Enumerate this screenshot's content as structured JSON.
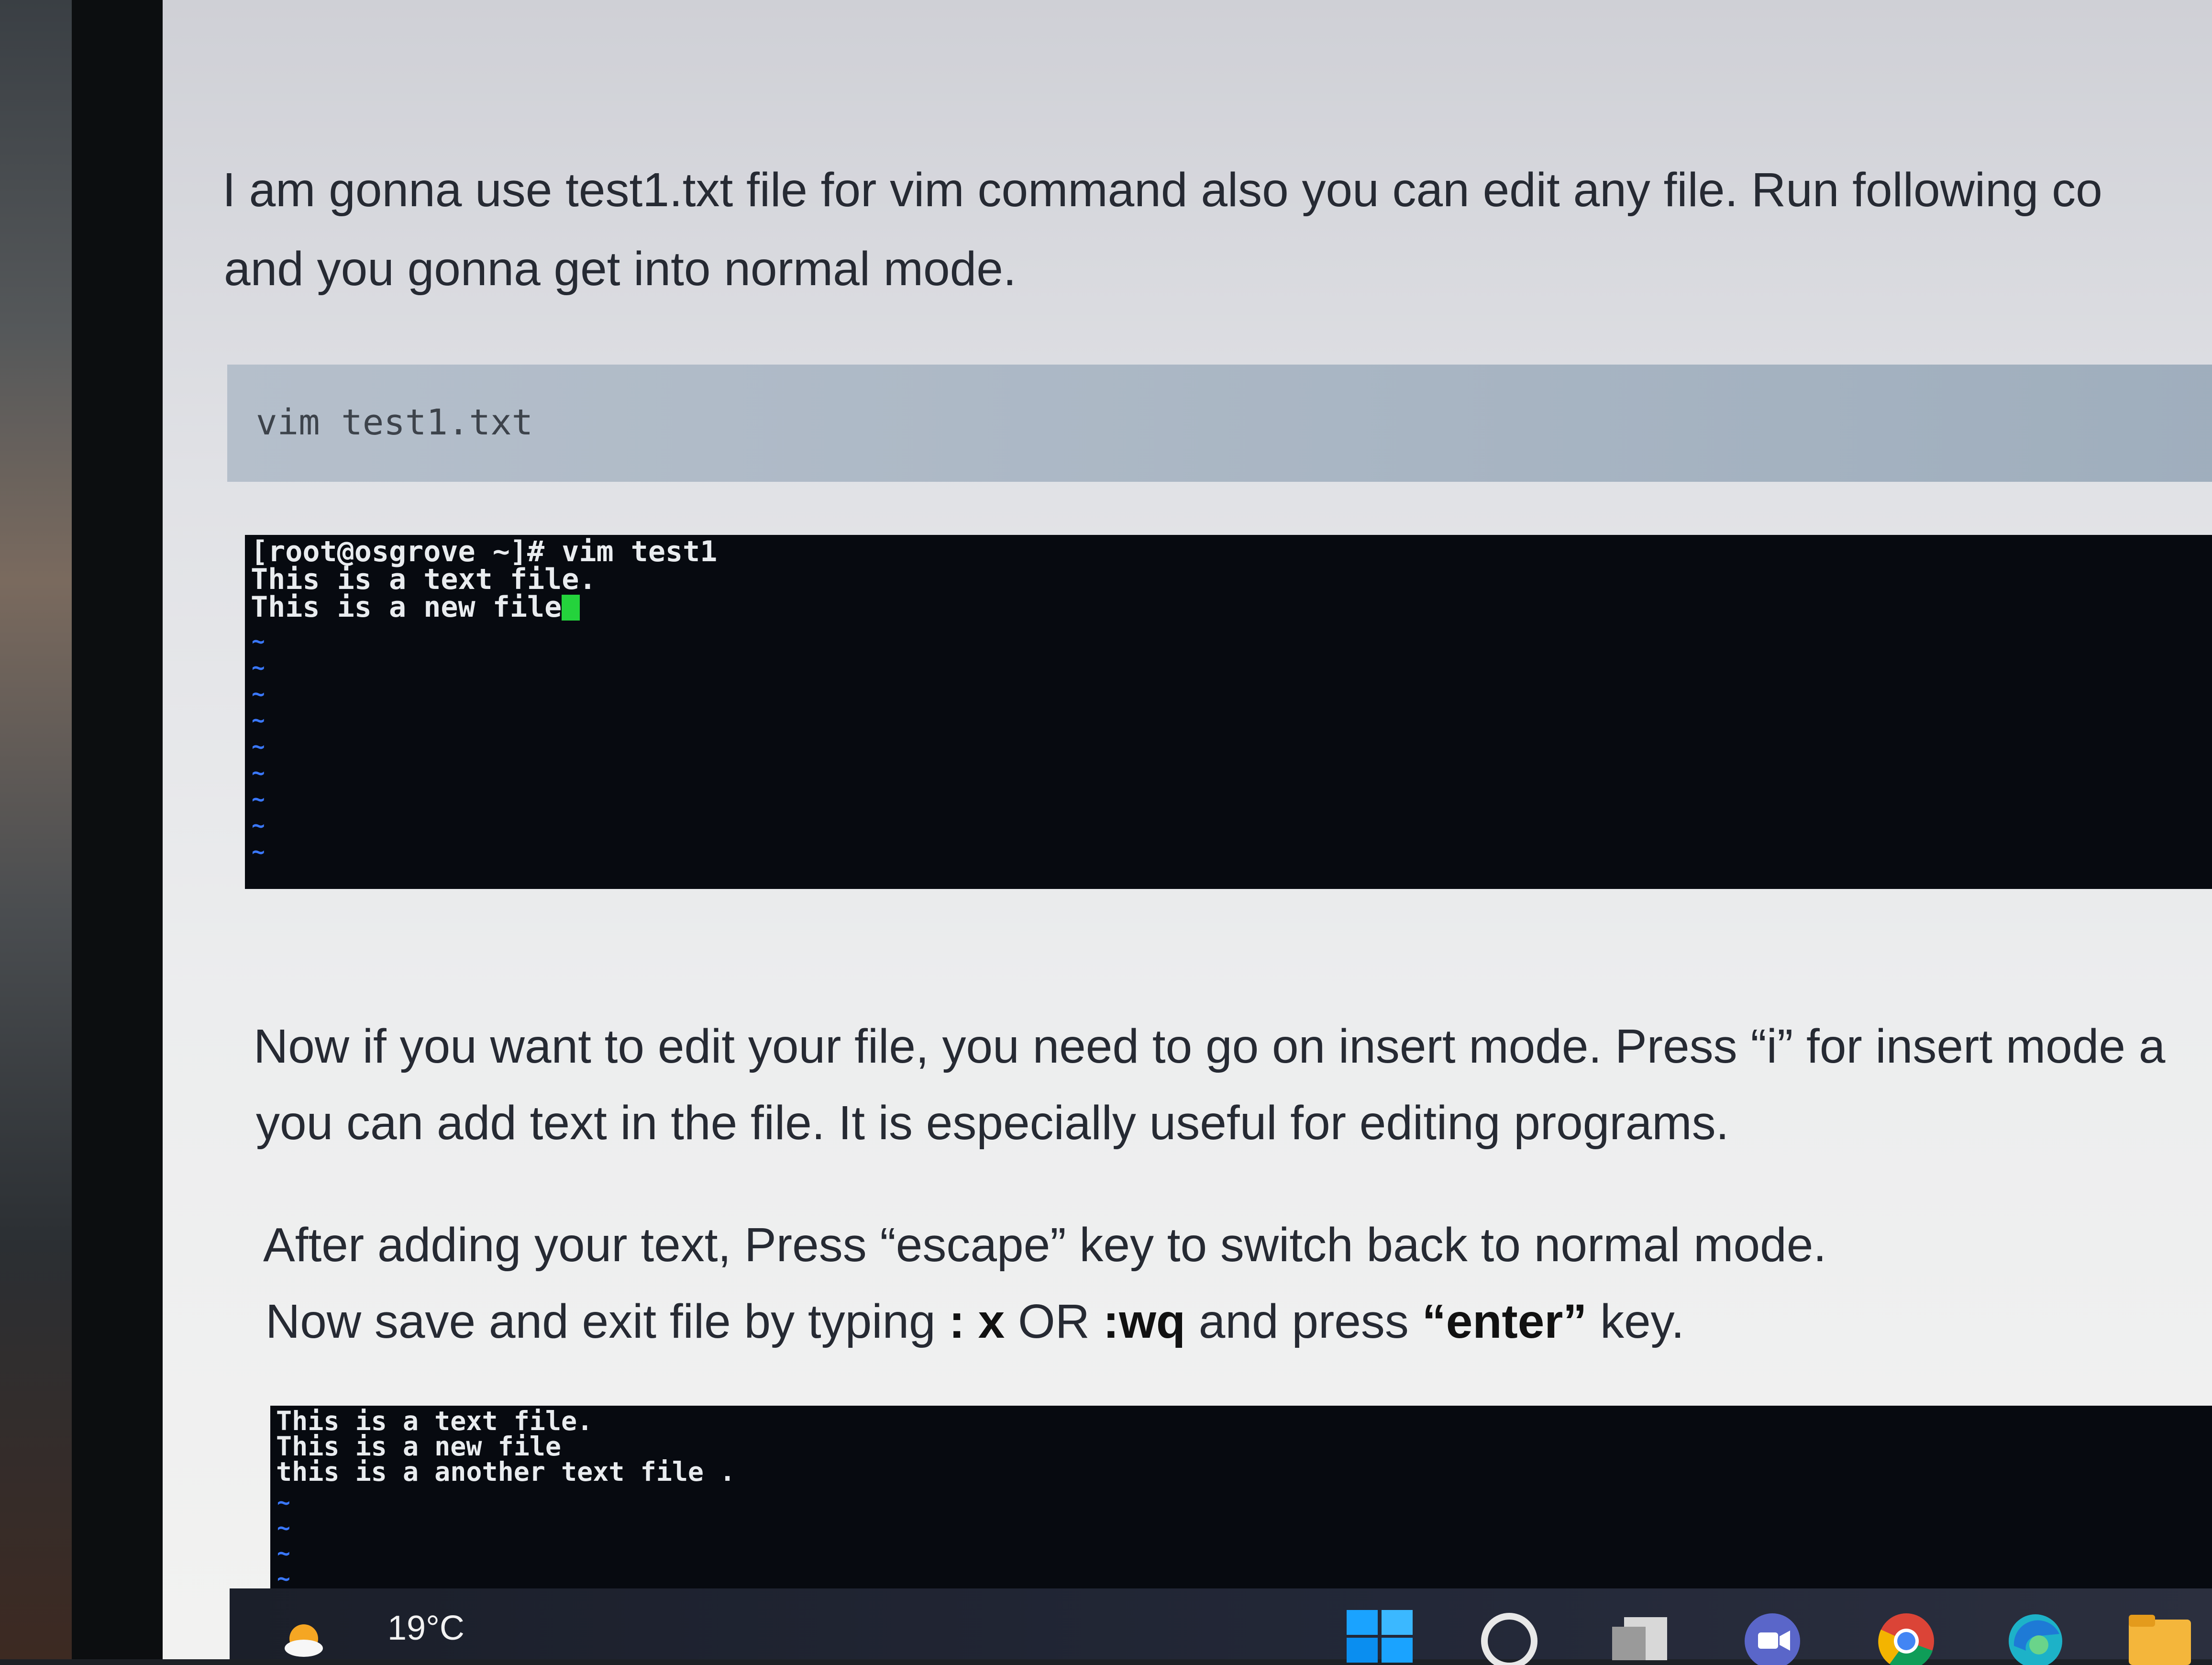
{
  "article": {
    "para1_line1": "I am gonna use test1.txt file for vim command also you can edit any file. Run following co",
    "para1_line2": "and you gonna get into normal mode.",
    "code_block": "vim test1.txt",
    "para2_line1": "Now if you want to edit your file, you need to go on insert mode. Press “i” for insert mode a",
    "para2_line2": "you can add text in the file. It is especially useful for editing programs.",
    "para3": "After adding your text, Press “escape” key to switch back to normal mode.",
    "para4_a": "Now save and exit file by typing ",
    "para4_x": ": x",
    "para4_or": " OR ",
    "para4_wq": ":wq",
    "para4_b": " and press ",
    "para4_enter": "“enter”",
    "para4_c": " key."
  },
  "terminal1": {
    "line1": "[root@osgrove ~]# vim test1",
    "line2": "This is a text file.",
    "line3": "This is a new file",
    "cursor_char": ".",
    "tilde": "~"
  },
  "terminal2": {
    "line1": "This is a text file.",
    "line2": "This is a new file",
    "line3": "this is a another text file .",
    "tilde": "~"
  },
  "taskbar": {
    "temperature": "19°C",
    "icons": [
      "weather-icon",
      "windows-start-icon",
      "search-icon",
      "task-view-icon",
      "teams-chat-icon",
      "chrome-icon",
      "edge-icon",
      "file-explorer-icon"
    ]
  },
  "colors": {
    "terminal_bg": "#070a10",
    "cursor": "#24d33c",
    "tilde": "#3a78ff",
    "code_block_bg": "#aab7c5"
  }
}
